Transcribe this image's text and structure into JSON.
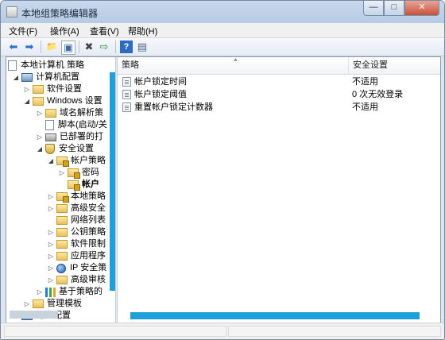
{
  "window": {
    "title": "本地组策略编辑器",
    "minimize": "—",
    "maximize": "□",
    "close": "✕"
  },
  "menu": [
    "文件(F)",
    "操作(A)",
    "查看(V)",
    "帮助(H)"
  ],
  "toolbar": {
    "back": "⬅",
    "forward": "➡",
    "up": "📁",
    "show_hide": "▣",
    "delete": "✖",
    "export": "⇨",
    "help": "?",
    "properties": "▤"
  },
  "tree": {
    "root": "本地计算机 策略",
    "computer_config": "计算机配置",
    "software_settings": "软件设置",
    "windows_settings": "Windows 设置",
    "name_resolution": "域名解析策",
    "scripts": "脚本(启动/关",
    "deployed_printers": "已部署的打",
    "security_settings": "安全设置",
    "account_policies": "帐户策略",
    "password_policy": "密码",
    "account_lockout": "帐户",
    "local_policies": "本地策略",
    "advanced_security": "高级安全",
    "network_list": "网络列表",
    "public_key": "公钥策略",
    "software_restriction": "软件限制",
    "app_control": "应用程序",
    "ip_security": "IP 安全策",
    "advanced_audit": "高级审核",
    "qos": "基于策略的",
    "admin_templates": "管理模板",
    "user_config": "用户配置"
  },
  "list": {
    "col_policy": "策略",
    "col_setting": "安全设置",
    "rows": [
      {
        "name": "帐户锁定时间",
        "setting": "不适用"
      },
      {
        "name": "帐户锁定阈值",
        "setting": "0 次无效登录"
      },
      {
        "name": "重置帐户锁定计数器",
        "setting": "不适用"
      }
    ]
  },
  "colors": {
    "accent_scroll": "#1ea1d8",
    "window_bg": "#dbe6f2"
  }
}
